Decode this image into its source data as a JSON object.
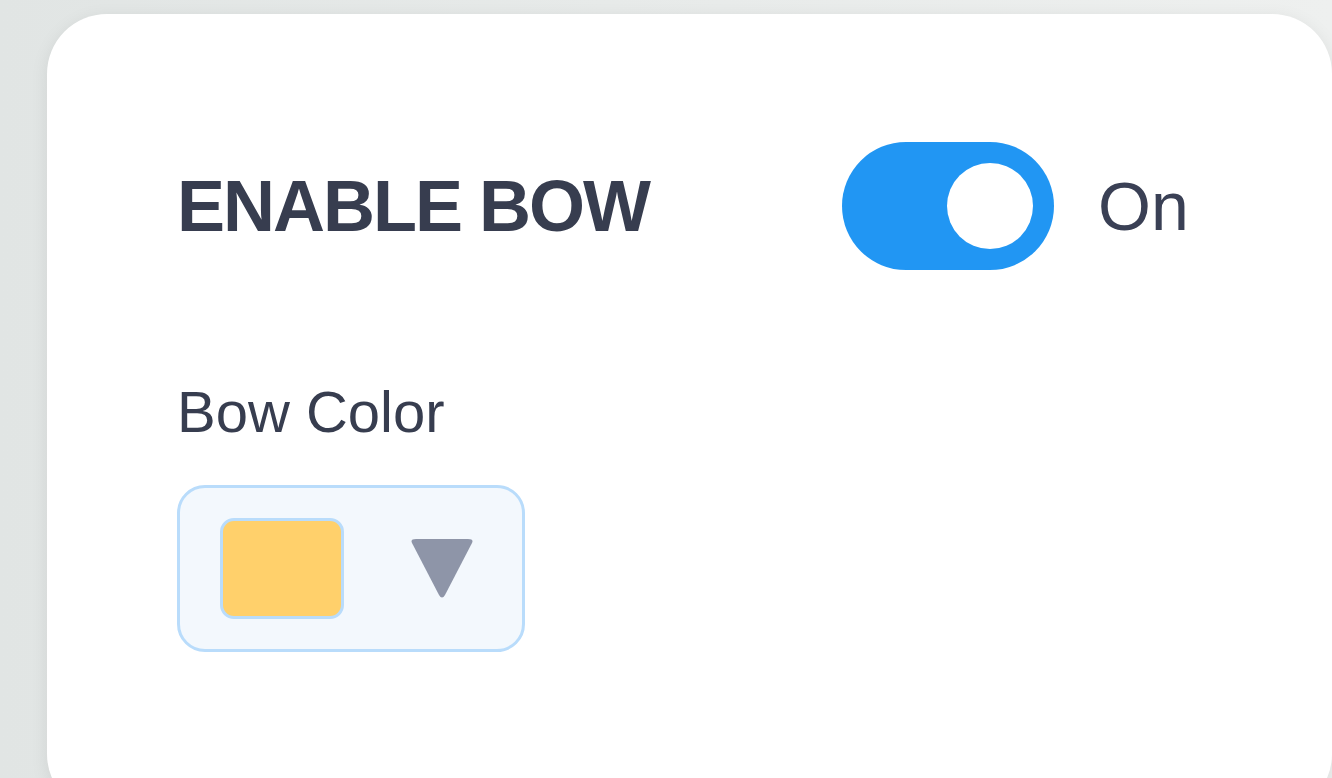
{
  "setting": {
    "label": "ENABLE BOW",
    "on": true,
    "state_label": "On"
  },
  "color_field": {
    "label": "Bow Color",
    "color": "#ffd06b"
  }
}
